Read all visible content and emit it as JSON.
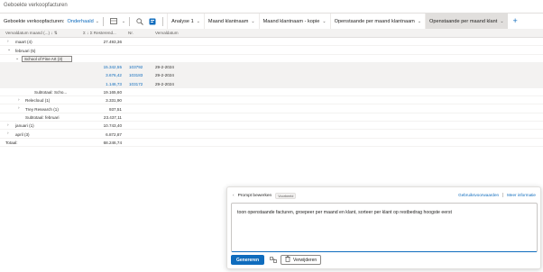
{
  "page": {
    "title": "Geboekte verkoopfacturen"
  },
  "toolbar": {
    "view_label": "Geboekte verkoopfacturen:",
    "view_value": "Onderhaald",
    "tabs": [
      {
        "label": "Analyse 1"
      },
      {
        "label": "Maand klantnaam"
      },
      {
        "label": "Maand klantnaam - kopie"
      },
      {
        "label": "Openstaande per maand klantnaam"
      },
      {
        "label": "Openstaande per maand klant"
      }
    ],
    "add": "+"
  },
  "grid": {
    "headers": {
      "col1": "Vervaldatum maand (...) ↓ ⇅",
      "col2": "Σ ↓ Σ Resterend...",
      "col3": "Nr.",
      "col4": "Vervaldatum"
    },
    "rows": [
      {
        "expander": "›",
        "label": "maart (4)",
        "amount": "27.493,36"
      },
      {
        "expander": "⌄",
        "label": "februari (5)",
        "amount": ""
      },
      {
        "expander": "⌄",
        "label": "School of Fine Art (3)",
        "amount": ""
      },
      {
        "label": "",
        "amount": "15.342,55",
        "nr": "103792",
        "date": "29-2-2024"
      },
      {
        "label": "",
        "amount": "3.676,42",
        "nr": "103183",
        "date": "29-2-2024"
      },
      {
        "label": "",
        "amount": "1.146,73",
        "nr": "103172",
        "date": "29-2-2024"
      },
      {
        "label": "Subtotaal: Scho...",
        "amount": "19.165,60"
      },
      {
        "expander": "›",
        "label": "Relecloud (1)",
        "amount": "3.331,90"
      },
      {
        "expander": "›",
        "label": "Trey Research (1)",
        "amount": "937,51"
      },
      {
        "label": "Subtotaal: februari",
        "amount": "23.437,11"
      },
      {
        "expander": "›",
        "label": "januari (1)",
        "amount": "10.743,40"
      },
      {
        "expander": "›",
        "label": "april (3)",
        "amount": "6.872,87"
      },
      {
        "label": "Totaal:",
        "amount": "68.246,74"
      }
    ]
  },
  "copilot": {
    "back_label": "Prompt bewerken",
    "badge": "Voorbeeld",
    "link_examples": "Gebruiksvoorwaarden",
    "link_more": "Meer informatie",
    "prompt_text": "toon openstaande facturen, groepeer per maand en klant, sorteer per klant op restbedrag hoogste eerst",
    "generate_label": "Genereren",
    "delete_label": "Verwijderen"
  },
  "colors": {
    "accent": "#0f6cbd",
    "active_tab": "#e1dfdd"
  }
}
